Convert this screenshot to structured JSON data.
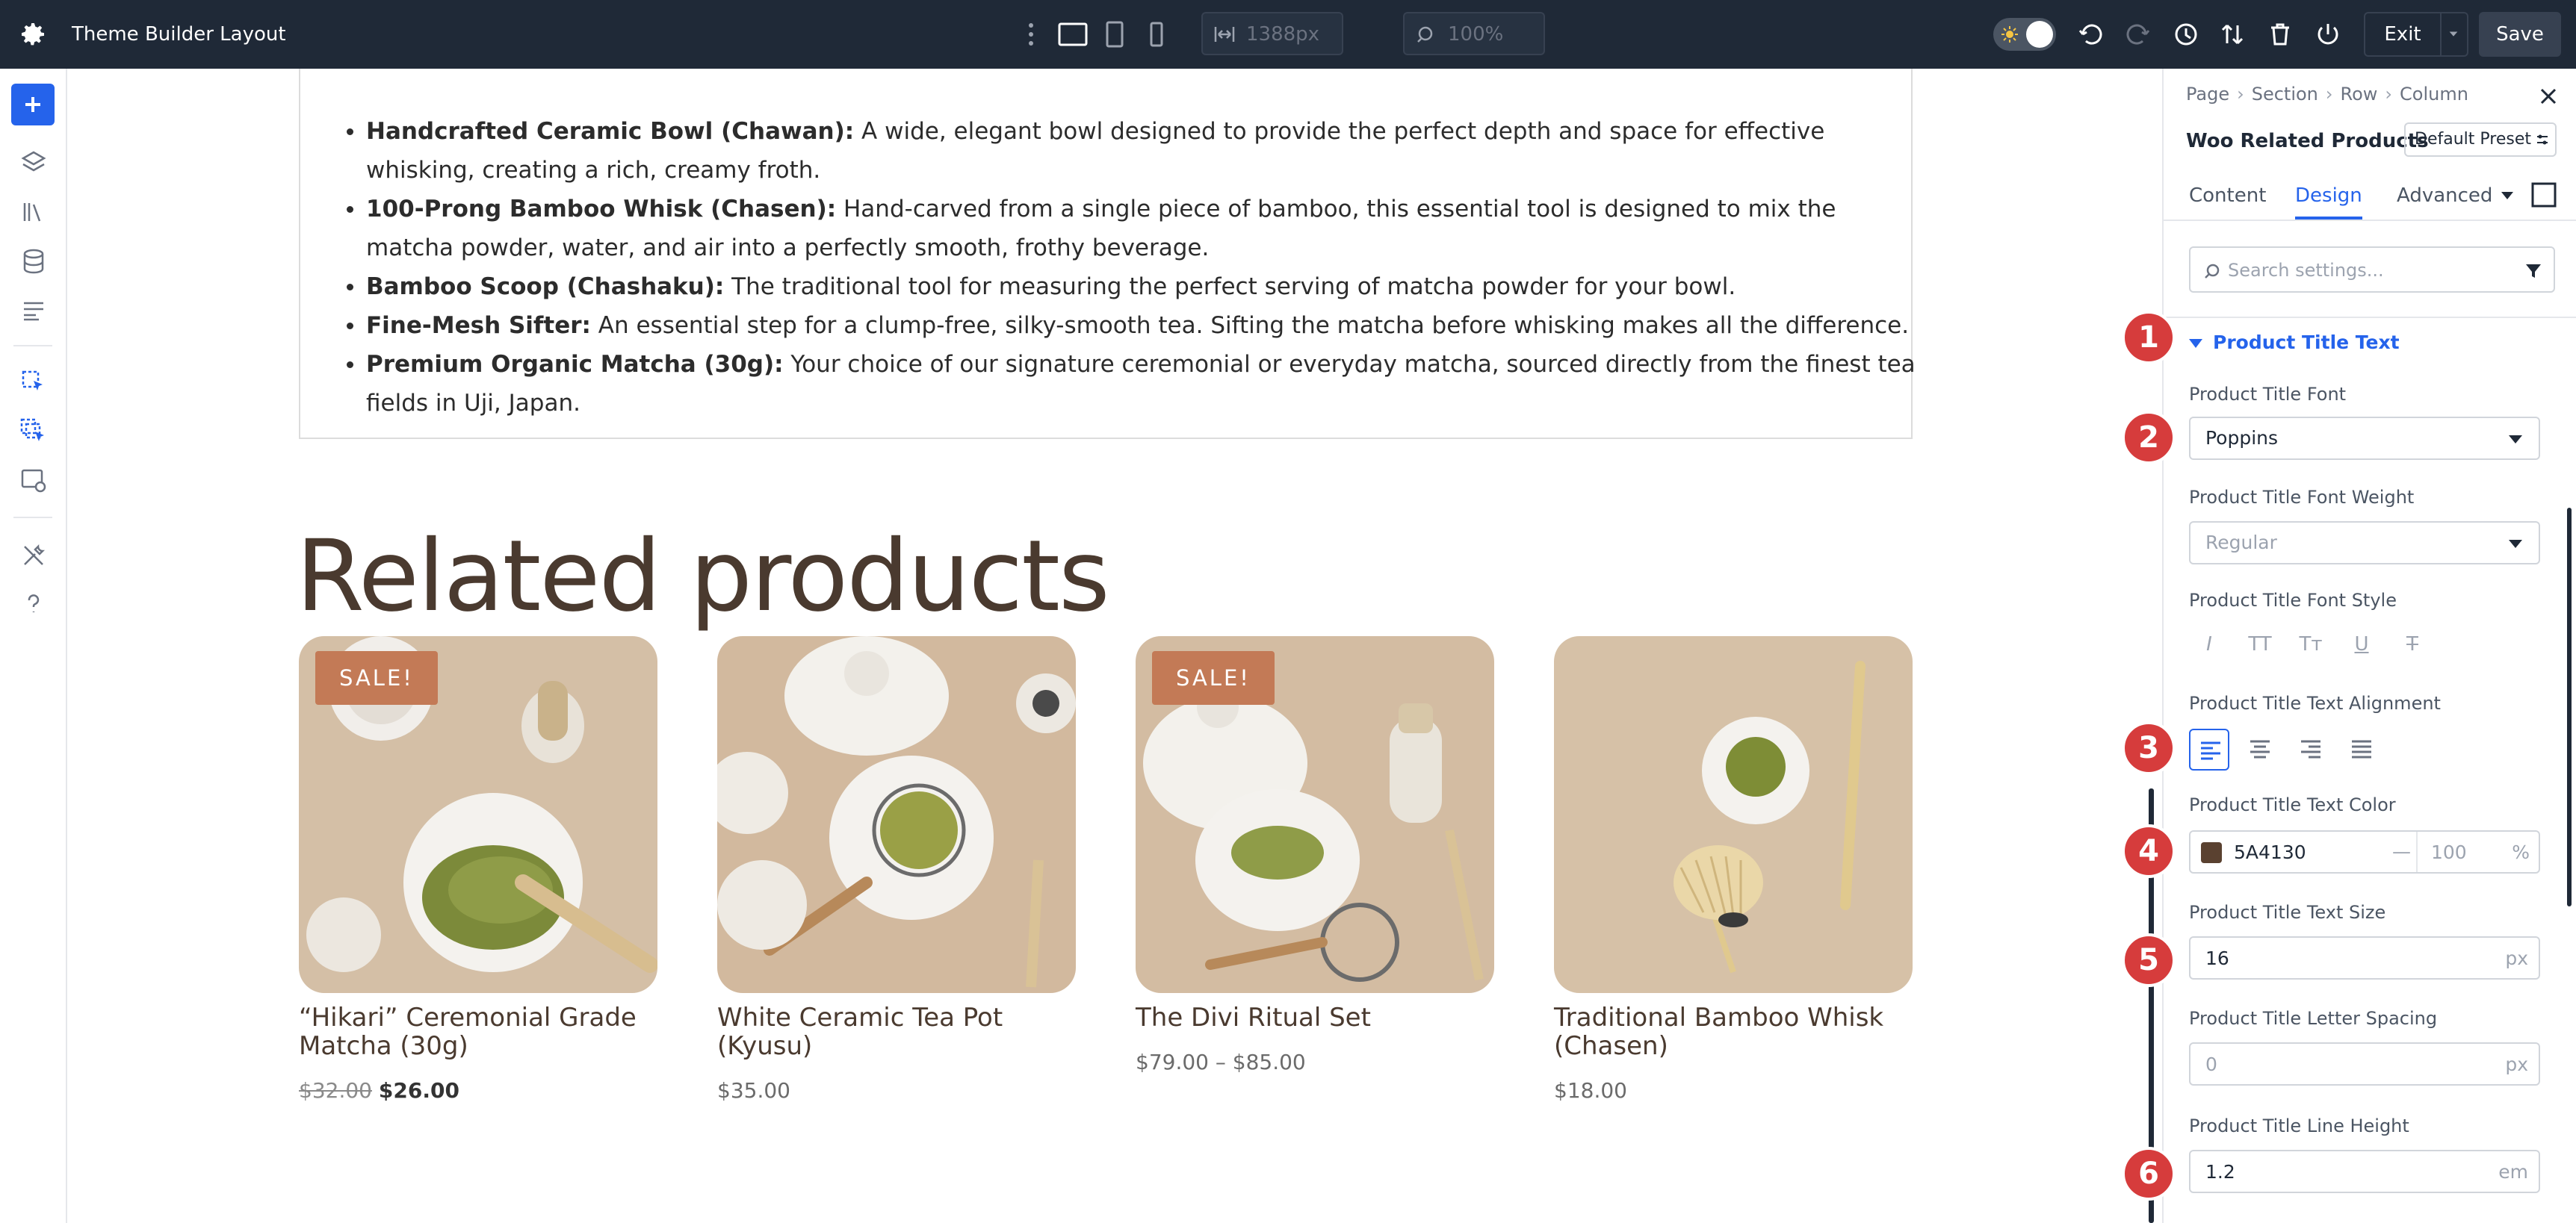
{
  "topbar": {
    "title": "Theme Builder Layout",
    "width_field": "1388px",
    "zoom_field": "100%",
    "exit_label": "Exit",
    "save_label": "Save"
  },
  "content": {
    "bullets": [
      {
        "bold": "Handcrafted Ceramic Bowl (Chawan):",
        "text": " A wide, elegant bowl designed to provide the perfect depth and space for effective whisking, creating a rich, creamy froth."
      },
      {
        "bold": "100-Prong Bamboo Whisk (Chasen):",
        "text": " Hand-carved from a single piece of bamboo, this essential tool is designed to mix the matcha powder, water, and air into a perfectly smooth, frothy beverage."
      },
      {
        "bold": "Bamboo Scoop (Chashaku):",
        "text": " The traditional tool for measuring the perfect serving of matcha powder for your bowl."
      },
      {
        "bold": "Fine-Mesh Sifter:",
        "text": " An essential step for a clump-free, silky-smooth tea. Sifting the matcha before whisking makes all the difference."
      },
      {
        "bold": "Premium Organic Matcha (30g):",
        "text": " Your choice of our signature ceremonial or everyday matcha, sourced directly from the finest tea fields in Uji, Japan."
      }
    ],
    "related_heading": "Related products",
    "products": [
      {
        "title": "“Hikari” Ceremonial Grade Matcha (30g)",
        "badge": "SALE!",
        "old_price": "$32.00",
        "price": "$26.00"
      },
      {
        "title": "White Ceramic Tea Pot (Kyusu)",
        "badge": "",
        "old_price": "",
        "price": "$35.00"
      },
      {
        "title": "The Divi Ritual Set",
        "badge": "SALE!",
        "old_price": "",
        "price": "$79.00 – $85.00"
      },
      {
        "title": "Traditional Bamboo Whisk (Chasen)",
        "badge": "",
        "old_price": "",
        "price": "$18.00"
      }
    ]
  },
  "panel": {
    "breadcrumbs": [
      "Page",
      "Section",
      "Row",
      "Column"
    ],
    "module_name": "Woo Related Products",
    "preset_label": "Default Preset",
    "tabs": [
      "Content",
      "Design",
      "Advanced"
    ],
    "active_tab": "Design",
    "search_placeholder": "Search settings...",
    "group_title": "Product Title Text",
    "font_label": "Product Title Font",
    "font_value": "Poppins",
    "weight_label": "Product Title Font Weight",
    "weight_value": "Regular",
    "style_label": "Product Title Font Style",
    "style_options": [
      "I",
      "TT",
      "Tт",
      "U",
      "T"
    ],
    "alignment_label": "Product Title Text Alignment",
    "color_label": "Product Title Text Color",
    "color_value": "5A4130",
    "color_swatch": "#5a4130",
    "opacity_value": "100",
    "opacity_unit": "%",
    "size_label": "Product Title Text Size",
    "size_value": "16",
    "size_unit": "px",
    "spacing_label": "Product Title Letter Spacing",
    "spacing_value": "0",
    "spacing_unit": "px",
    "line_height_label": "Product Title Line Height",
    "line_height_value": "1.2",
    "line_height_unit": "em"
  },
  "badges": [
    "1",
    "2",
    "3",
    "4",
    "5",
    "6"
  ],
  "colors": {
    "accent": "#2563eb",
    "brand_text": "#4a3a2f",
    "sale": "#c37a56",
    "badge": "#d63c3c",
    "topbar": "#1f2937"
  }
}
